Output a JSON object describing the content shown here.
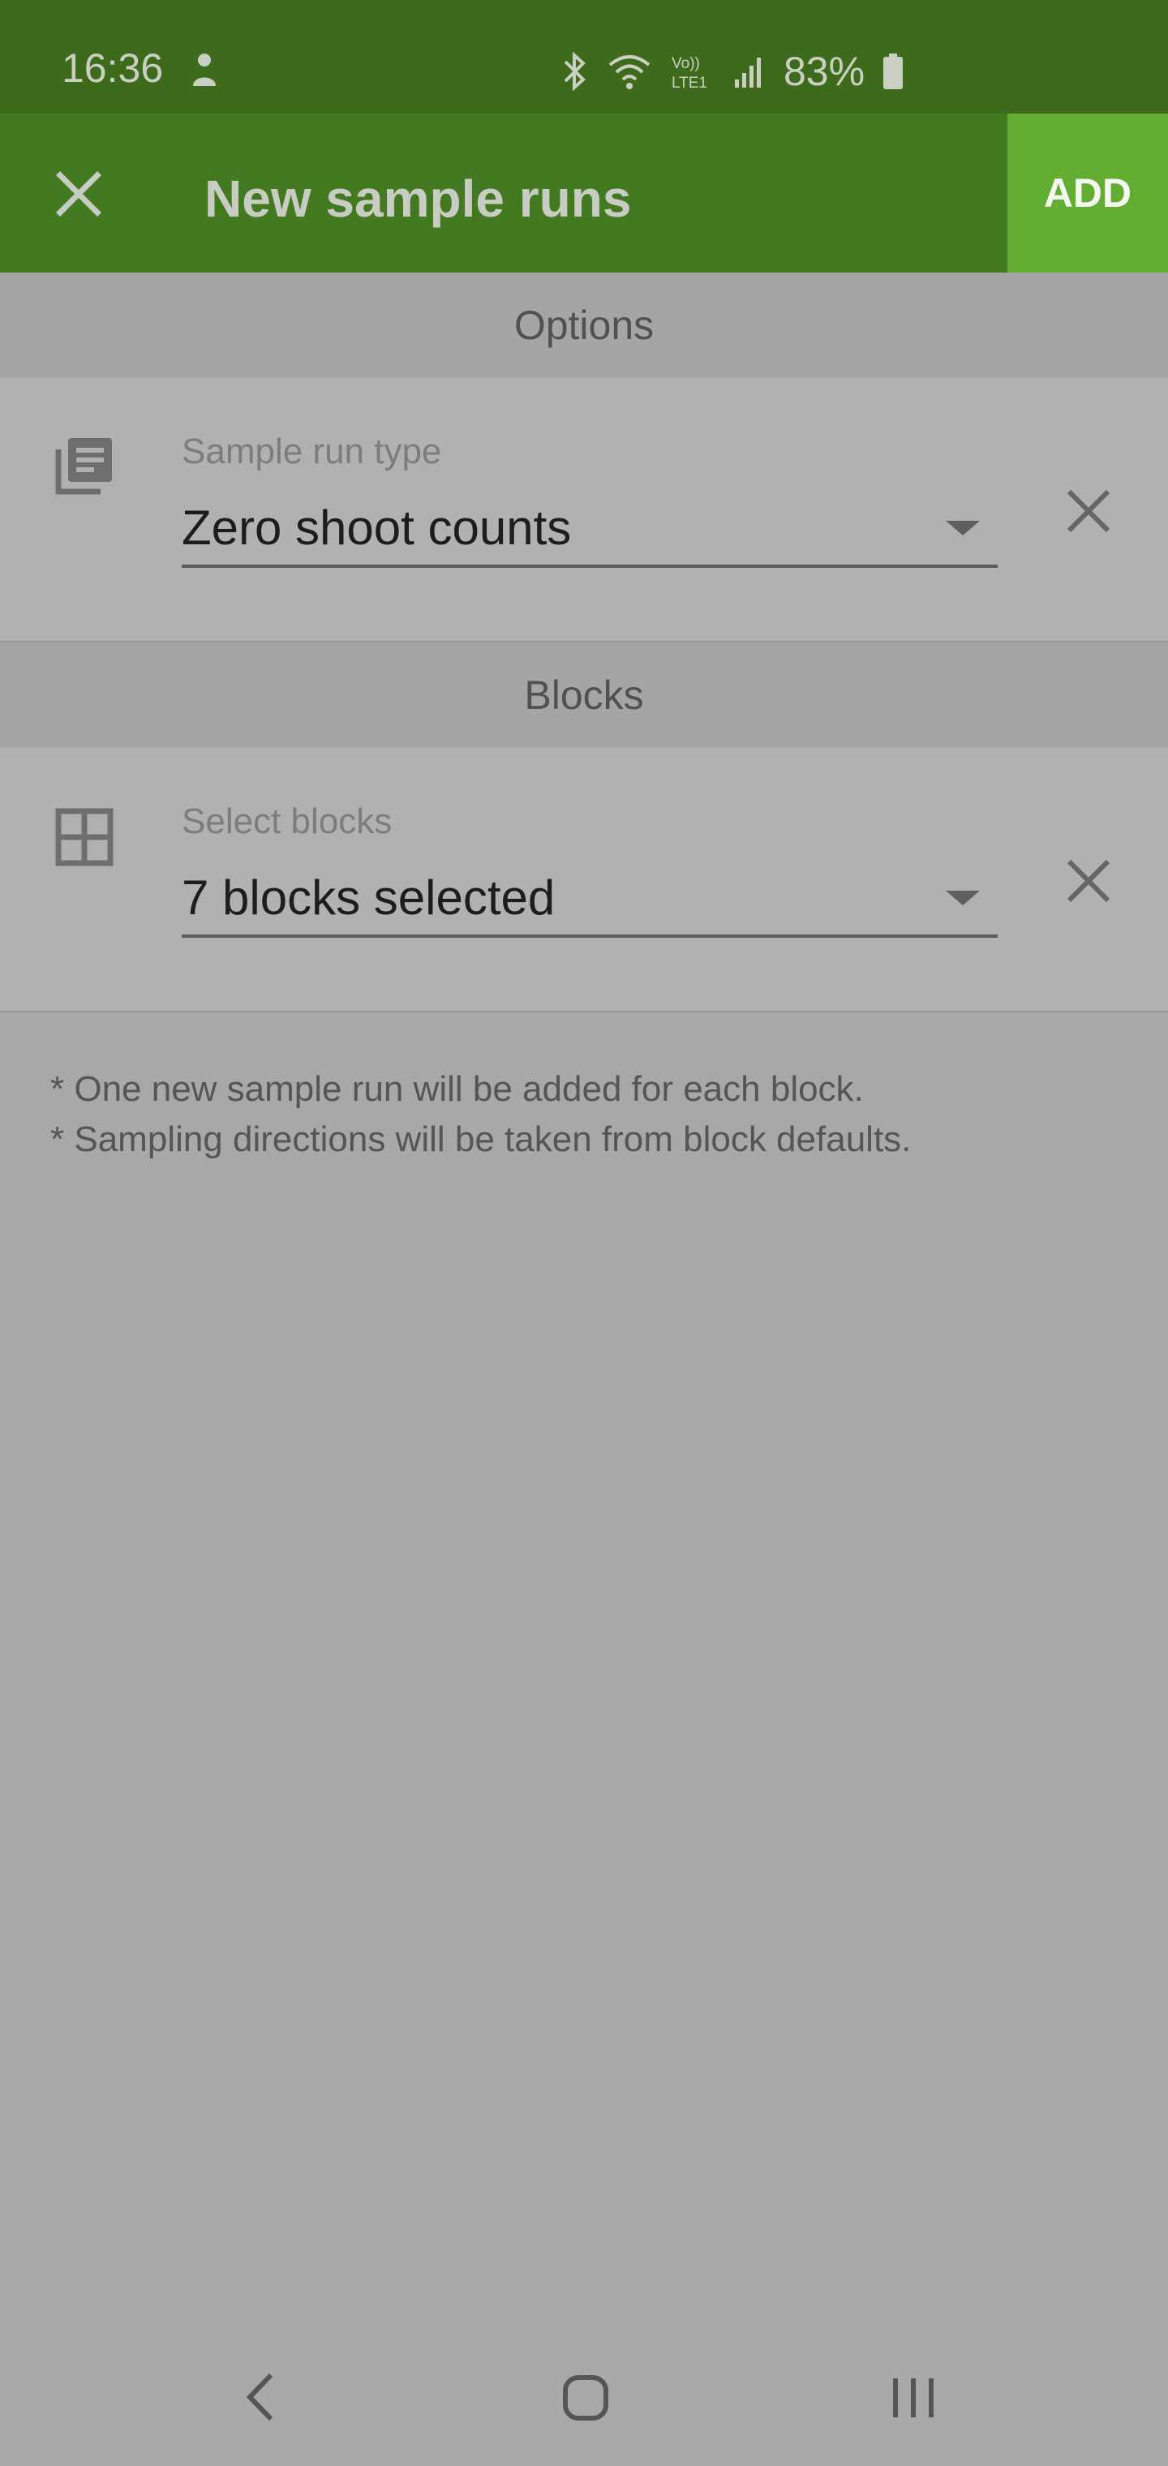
{
  "status_bar": {
    "time": "16:36",
    "battery": "83%",
    "icons": [
      "person-icon",
      "bluetooth-icon",
      "wifi-icon",
      "volte-icon",
      "signal-icon",
      "battery-icon"
    ]
  },
  "app_bar": {
    "title": "New sample runs",
    "add_label": "ADD",
    "close_icon": "close-icon",
    "colors": {
      "status": "#3d6b1b",
      "bar": "#437a21",
      "add": "#64ad33"
    }
  },
  "options": {
    "header": "Options",
    "sample_run_type": {
      "label": "Sample run type",
      "value": "Zero shoot counts",
      "icon": "library-books-icon"
    }
  },
  "blocks": {
    "header": "Blocks",
    "select_blocks": {
      "label": "Select blocks",
      "value": "7 blocks selected",
      "icon": "grid-icon"
    }
  },
  "notes": [
    "* One new sample run will be added for each block.",
    "* Sampling directions will be taken from block defaults."
  ],
  "nav_bar": {
    "icons": [
      "back-icon",
      "home-icon",
      "recent-apps-icon"
    ]
  }
}
